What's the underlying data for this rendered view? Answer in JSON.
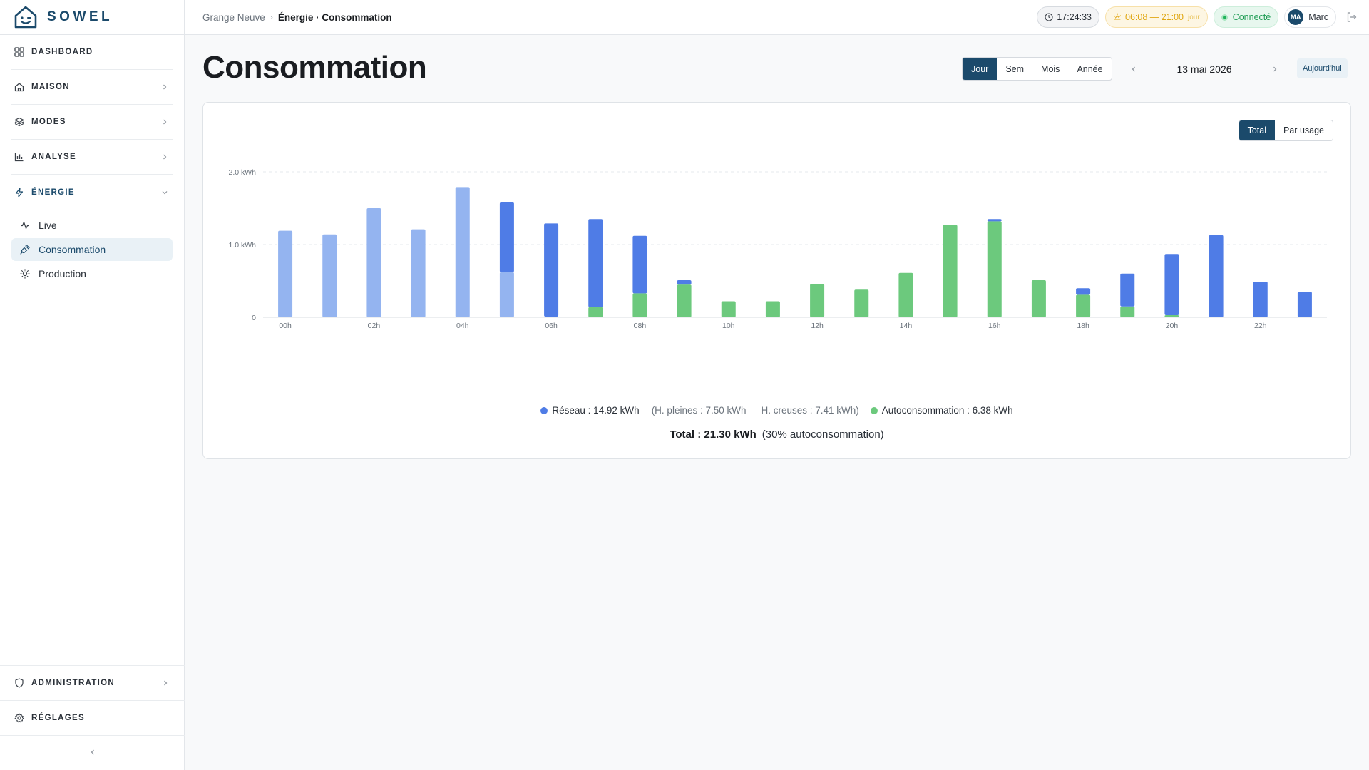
{
  "app": {
    "brand": "SOWEL"
  },
  "sidebar": {
    "items": [
      {
        "label": "DASHBOARD"
      },
      {
        "label": "MAISON"
      },
      {
        "label": "MODES"
      },
      {
        "label": "ANALYSE"
      },
      {
        "label": "ÉNERGIE"
      }
    ],
    "energie_sub": [
      {
        "label": "Live"
      },
      {
        "label": "Consommation"
      },
      {
        "label": "Production"
      }
    ],
    "bottom": [
      {
        "label": "ADMINISTRATION"
      },
      {
        "label": "RÉGLAGES"
      }
    ]
  },
  "topbar": {
    "breadcrumb_home": "Grange Neuve",
    "breadcrumb_sep": "›",
    "breadcrumb_current": "Énergie · Consommation",
    "clock": "17:24:33",
    "sun_range": "06:08 — 21:00",
    "sun_state": "jour",
    "status": "Connecté",
    "user_initials": "MA",
    "user_name": "Marc"
  },
  "page": {
    "title": "Consommation",
    "periods": [
      "Jour",
      "Sem",
      "Mois",
      "Année"
    ],
    "active_period": "Jour",
    "date": "13 mai 2026",
    "today": "Aujourd'hui",
    "modes": [
      "Total",
      "Par usage"
    ],
    "active_mode": "Total"
  },
  "chart_data": {
    "type": "bar",
    "stacked": true,
    "y_unit": "kWh",
    "ylim": [
      0,
      2.0
    ],
    "y_ticks": [
      {
        "value": 0,
        "label": "0"
      },
      {
        "value": 1.0,
        "label": "1.0 kWh"
      },
      {
        "value": 2.0,
        "label": "2.0 kWh"
      }
    ],
    "categories": [
      "00h",
      "01h",
      "02h",
      "03h",
      "04h",
      "05h",
      "06h",
      "07h",
      "08h",
      "09h",
      "10h",
      "11h",
      "12h",
      "13h",
      "14h",
      "15h",
      "16h",
      "17h",
      "18h",
      "19h",
      "20h",
      "21h",
      "22h",
      "23h"
    ],
    "x_tick_labels": [
      "00h",
      "",
      "02h",
      "",
      "04h",
      "",
      "06h",
      "",
      "08h",
      "",
      "10h",
      "",
      "12h",
      "",
      "14h",
      "",
      "16h",
      "",
      "18h",
      "",
      "20h",
      "",
      "22h",
      ""
    ],
    "series": [
      {
        "name": "Autoconsommation",
        "color": "#6cc97d",
        "values": [
          0,
          0,
          0,
          0,
          0,
          0,
          0.01,
          0.14,
          0.33,
          0.45,
          0.22,
          0.22,
          0.46,
          0.38,
          0.61,
          1.27,
          1.32,
          0.51,
          0.31,
          0.15,
          0.03,
          0,
          0,
          0
        ]
      },
      {
        "name": "Réseau H. creuses",
        "color": "#94b4f0",
        "values": [
          1.19,
          1.14,
          1.5,
          1.21,
          1.79,
          0.62,
          0,
          0,
          0,
          0,
          0,
          0,
          0,
          0,
          0,
          0,
          0,
          0,
          0,
          0,
          0,
          0,
          0,
          0
        ]
      },
      {
        "name": "Réseau H. pleines",
        "color": "#4f7ce6",
        "values": [
          0,
          0,
          0,
          0,
          0,
          0.96,
          1.28,
          1.21,
          0.79,
          0.06,
          0,
          0,
          0,
          0,
          0,
          0,
          0.03,
          0,
          0.09,
          0.45,
          0.84,
          1.13,
          0.49,
          0.35
        ]
      }
    ],
    "legend": {
      "reseau": "Réseau : 14.92 kWh",
      "reseau_detail": "(H. pleines : 7.50 kWh — H. creuses : 7.41 kWh)",
      "auto": "Autoconsommation : 6.38 kWh",
      "reseau_color": "#4f7ce6",
      "auto_color": "#6cc97d"
    },
    "total": "Total : 21.30 kWh",
    "total_detail": "(30% autoconsommation)"
  }
}
